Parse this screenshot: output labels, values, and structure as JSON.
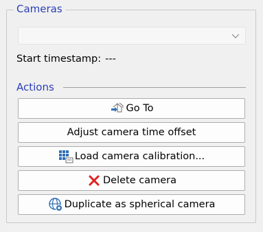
{
  "cameras_group": {
    "title": "Cameras",
    "camera_select": {
      "selected_value": ""
    },
    "start_timestamp": {
      "label": "Start timestamp:",
      "value": "---"
    }
  },
  "actions_group": {
    "title": "Actions",
    "buttons": [
      {
        "label": "Go To",
        "icon": "go-to-icon"
      },
      {
        "label": "Adjust camera time offset",
        "icon": ""
      },
      {
        "label": "Load camera calibration...",
        "icon": "calibration-grid-icon"
      },
      {
        "label": "Delete camera",
        "icon": "delete-x-icon"
      },
      {
        "label": "Duplicate as spherical camera",
        "icon": "globe-camera-icon"
      }
    ]
  },
  "colors": {
    "group_title": "#2b3fb8",
    "delete_icon": "#e02020",
    "icon_blue": "#2f6fb3"
  }
}
